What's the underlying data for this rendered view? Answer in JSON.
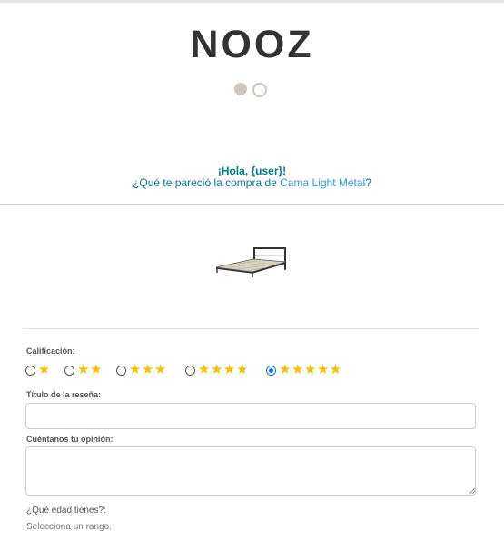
{
  "brand": {
    "logo_text": "NOOZ",
    "logo_mark": "nooz-dots-logo"
  },
  "header": {
    "greeting": "¡Hola, {user}!",
    "question_prefix": "¿Qué te pareció la compra de ",
    "product_name": "Cama Light Metal",
    "question_suffix": "?"
  },
  "product": {
    "image": "metal-bed-frame-image"
  },
  "form": {
    "rating_label": "Calificación:",
    "rating_options": [
      {
        "stars": "★",
        "value": 1,
        "selected": false
      },
      {
        "stars": "★★",
        "value": 2,
        "selected": false
      },
      {
        "stars": "★★★",
        "value": 3,
        "selected": false
      },
      {
        "stars": "★★★★",
        "value": 4,
        "selected": false
      },
      {
        "stars": "★★★★★",
        "value": 5,
        "selected": true
      }
    ],
    "title_label": "Título de la reseña:",
    "title_value": "",
    "opinion_label": "Cuéntanos tu opinión:",
    "opinion_value": "",
    "age_label": "¿Qué edad tienes?:",
    "age_selected": "Selecciona un rango."
  },
  "colors": {
    "accent_teal": "#007c89",
    "link_blue": "#2e9ad6",
    "star_yellow": "#f2c200",
    "logo_beige": "#cfc6bc"
  }
}
